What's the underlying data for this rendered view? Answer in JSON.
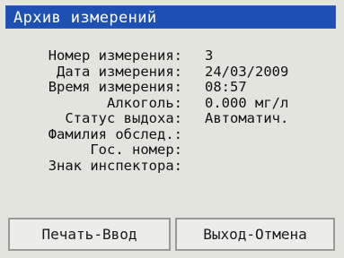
{
  "window": {
    "title": "Архив измерений"
  },
  "record": {
    "fields": [
      {
        "label": "Номер измерения:",
        "value": "3"
      },
      {
        "label": "Дата измерения:",
        "value": "24/03/2009"
      },
      {
        "label": "Время измерения:",
        "value": "08:57"
      },
      {
        "label": "Алкоголь:",
        "value": "0.000 мг/л"
      },
      {
        "label": "Статус выдоха:",
        "value": "Автоматич."
      },
      {
        "label": "Фамилия обслед.:",
        "value": ""
      },
      {
        "label": "Гос. номер:",
        "value": ""
      },
      {
        "label": "Знак инспектора:",
        "value": ""
      }
    ]
  },
  "buttons": {
    "print_label": "Печать-Ввод",
    "exit_label": "Выход-Отмена"
  },
  "colors": {
    "titlebar": "#1e50b4",
    "screen": "#e4e4de"
  }
}
